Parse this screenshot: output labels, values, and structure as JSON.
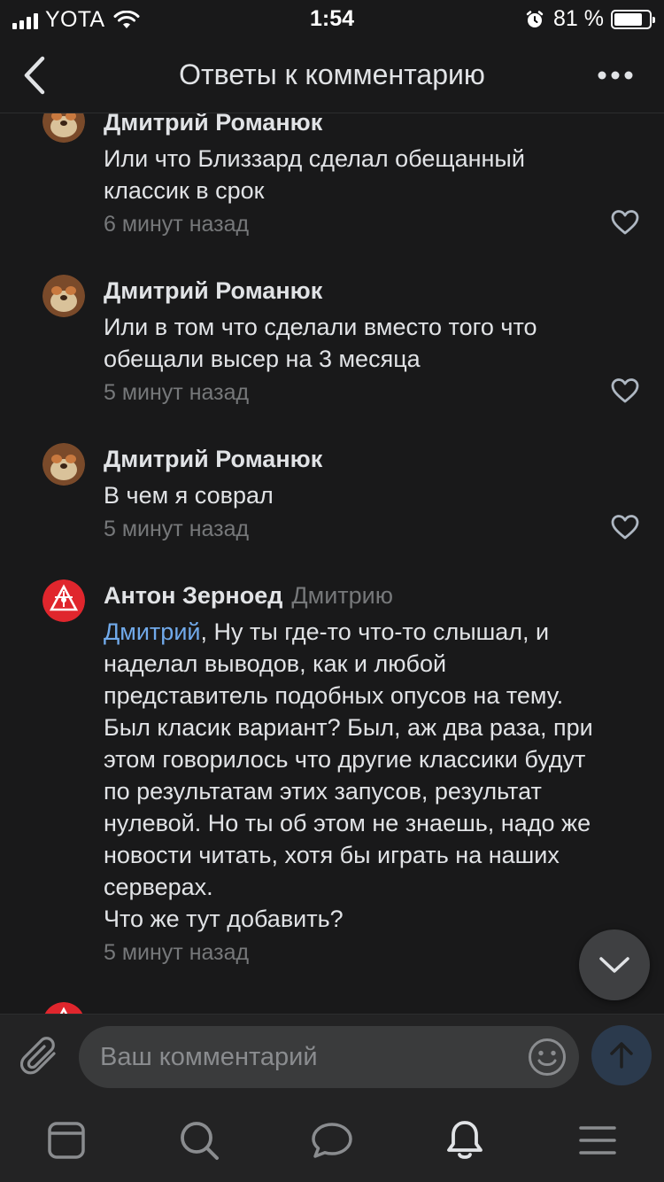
{
  "status_bar": {
    "carrier": "YOTA",
    "time": "1:54",
    "battery_percent": "81 %",
    "battery_level": 0.81
  },
  "header": {
    "title": "Ответы к комментарию"
  },
  "comments": [
    {
      "author": "Дмитрий Романюк",
      "reply_to": "",
      "text_lines": [
        "Или что Близзард сделал обещанный",
        "классик в срок"
      ],
      "time": "6 минут назад"
    },
    {
      "author": "Дмитрий Романюк",
      "reply_to": "",
      "text_lines": [
        "Или в том что сделали вместо того что",
        "обещали высер на 3 месяца"
      ],
      "time": "5 минут назад"
    },
    {
      "author": "Дмитрий Романюк",
      "reply_to": "",
      "text_lines": [
        "В чем я соврал"
      ],
      "time": "5 минут назад"
    },
    {
      "author": "Антон Зерноед",
      "reply_to": "Дмитрию",
      "mention": "Дмитрий",
      "text_first_rest": ", Ну ты где-то что-то слышал, и",
      "text_lines": [
        "наделал выводов, как и любой",
        "представитель подобных опусов на тему.",
        "Был класик вариант? Был, аж два раза, при",
        "этом говорилось что другие классики будут",
        "по результатам этих запусов, результат",
        "нулевой. Но ты об этом не знаешь, надо же",
        "новости читать, хотя бы играть на наших",
        "серверах.",
        "Что же тут добавить?"
      ],
      "time": "5 минут назад"
    }
  ],
  "composer": {
    "placeholder": "Ваш комментарий"
  },
  "icons": {
    "back": "chevron-left-icon",
    "more": "more-horizontal-icon",
    "like": "heart-outline-icon",
    "scroll_down": "chevron-down-icon",
    "attach": "paperclip-icon",
    "emoji": "smile-icon",
    "send": "arrow-up-icon",
    "tabs": [
      "news-icon",
      "search-icon",
      "messages-icon",
      "notifications-icon",
      "menu-icon"
    ]
  },
  "colors": {
    "background": "#19191a",
    "text": "#e1e3e6",
    "secondary_text": "#76787a",
    "mention": "#71aaeb",
    "send_button": "#2b3a4d"
  }
}
